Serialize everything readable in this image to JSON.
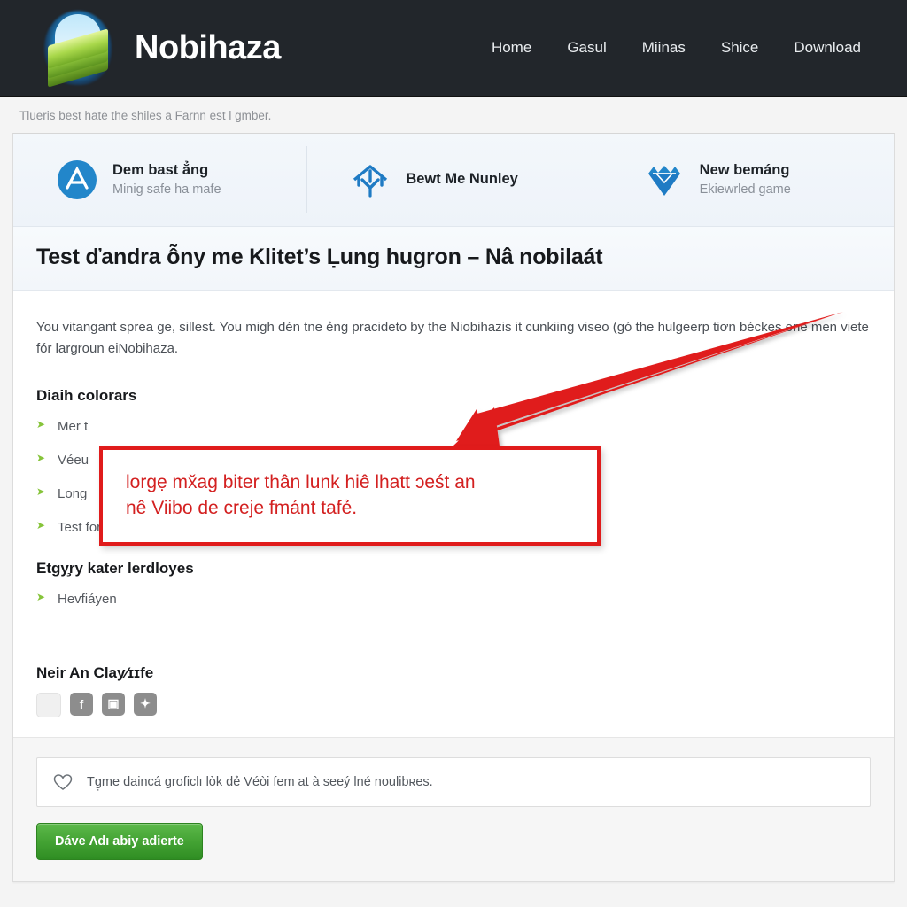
{
  "header": {
    "brand_name": "Nobihaza",
    "logo_icon": "isometric-grass-block-logo",
    "sprout_icon": "sprout-arrow-icon",
    "nav": [
      {
        "label": "Home",
        "name": "nav-home"
      },
      {
        "label": "Gasul",
        "name": "nav-gasul"
      },
      {
        "label": "Miinas",
        "name": "nav-miinas"
      },
      {
        "label": "Shice",
        "name": "nav-shice"
      },
      {
        "label": "Download",
        "name": "nav-download"
      }
    ]
  },
  "breadcrumb": "Tlueris best hate the shiles a Farnn est l gmber.",
  "features": [
    {
      "icon": "circle-a-badge-icon",
      "title": "Dem bast ẳng",
      "subtitle": "Minig safe ha mafe"
    },
    {
      "icon": "download-house-icon",
      "title": "Bewt Me Nunley",
      "subtitle": ""
    },
    {
      "icon": "diamond-gem-icon",
      "title": "New bemáng",
      "subtitle": "Ekiewrled game"
    }
  ],
  "page_title": "Test ďandra ỗny me Klitet’s Ḷung hugron – Nâ nobilaát",
  "lede": "You vitangant sprea ge, sillest. You migh dén tne ẻng pracideto by the Niobihazis it cunkiing viseo (gó the hulgeerp tiơn béckes ene men viete fór largroun eiNobihaza.",
  "sections": [
    {
      "heading": "Diaih colorars",
      "items": [
        "Mer t",
        "Véeu",
        "Long",
        "Test for not ane than Viitx"
      ]
    },
    {
      "heading": "Etgy̧ry kater lerdloyes",
      "items": [
        "Hevﬁáyen"
      ]
    }
  ],
  "share": {
    "heading": "Neir An Clay⁄ɪɪfe",
    "buttons": [
      {
        "icon": "blank-share-icon",
        "glyph": ""
      },
      {
        "icon": "facebook-icon",
        "glyph": "f"
      },
      {
        "icon": "image-share-icon",
        "glyph": "▣"
      },
      {
        "icon": "thumbs-up-icon",
        "glyph": "✦"
      }
    ]
  },
  "notice": {
    "icon": "heart-icon",
    "text": "Tg̣me daincá groficlı lòk dẻ Véòi fem at à seeý lné noulibʀes."
  },
  "cta_label": "Dáve Ʌdı abiy adierte",
  "annotation": {
    "text_line_1": "lorgẹ mx̌ag biter thân lunk hiê lhatt ɔeśt an",
    "text_line_2": "nê Viibo de creje fmánt tafẻ.",
    "color": "#d32020",
    "border_color": "#e01b1b",
    "arrow": "red-pointer-arrow"
  },
  "colors": {
    "header_bg": "#22262b",
    "accent_green": "#43a233",
    "feature_blue": "#1f7bc4",
    "bullet_green": "#86c43a",
    "annotation_red": "#e01b1b"
  }
}
